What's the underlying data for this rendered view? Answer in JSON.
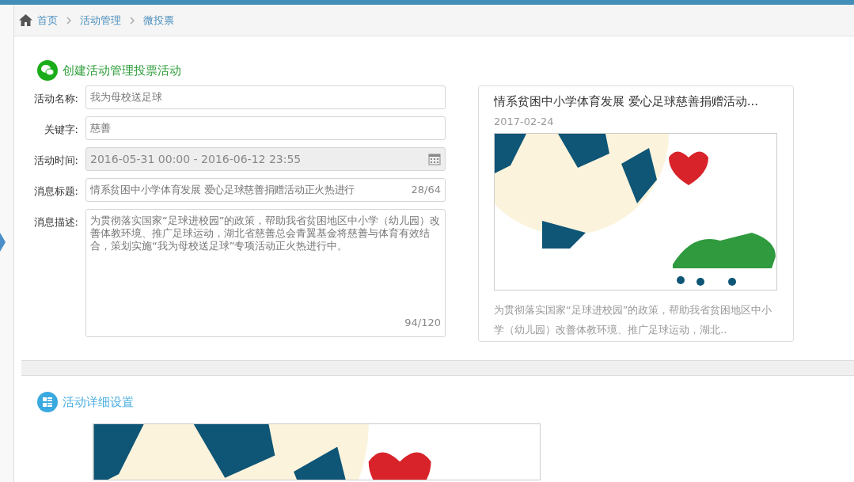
{
  "breadcrumb": [
    {
      "label": "首页"
    },
    {
      "label": "活动管理"
    },
    {
      "label": "微投票"
    }
  ],
  "section1": {
    "title": "创建活动管理投票活动"
  },
  "form": [
    {
      "kind": "text",
      "label": "活动名称:",
      "value": "我为母校送足球"
    },
    {
      "kind": "text",
      "label": "关键字:",
      "value": "慈善"
    },
    {
      "kind": "date",
      "label": "活动时间:",
      "value": "2016-05-31 00:00 - 2016-06-12 23:55",
      "disabled": true
    },
    {
      "kind": "counted",
      "label": "消息标题:",
      "value": "情系贫困中小学体育发展 爱心足球慈善捐赠活动正火热进行",
      "counter": "28/64"
    },
    {
      "kind": "textarea",
      "label": "消息描述:",
      "value": "为贯彻落实国家“足球进校园”的政策，帮助我省贫困地区中小学（幼儿园）改善体教环境、推广足球运动，湖北省慈善总会青翼基金将慈善与体育有效结合，策划实施“我为母校送足球”专项活动正火热进行中。",
      "counter": "94/120"
    }
  ],
  "preview": {
    "title": "情系贫困中小学体育发展 爱心足球慈善捐赠活动...",
    "date": "2017-02-24",
    "description": "为贯彻落实国家“足球进校园”的政策，帮助我省贫困地区中小学（幼儿园）改善体教环境、推广足球运动，湖北.."
  },
  "section2": {
    "title": "活动详细设置"
  }
}
